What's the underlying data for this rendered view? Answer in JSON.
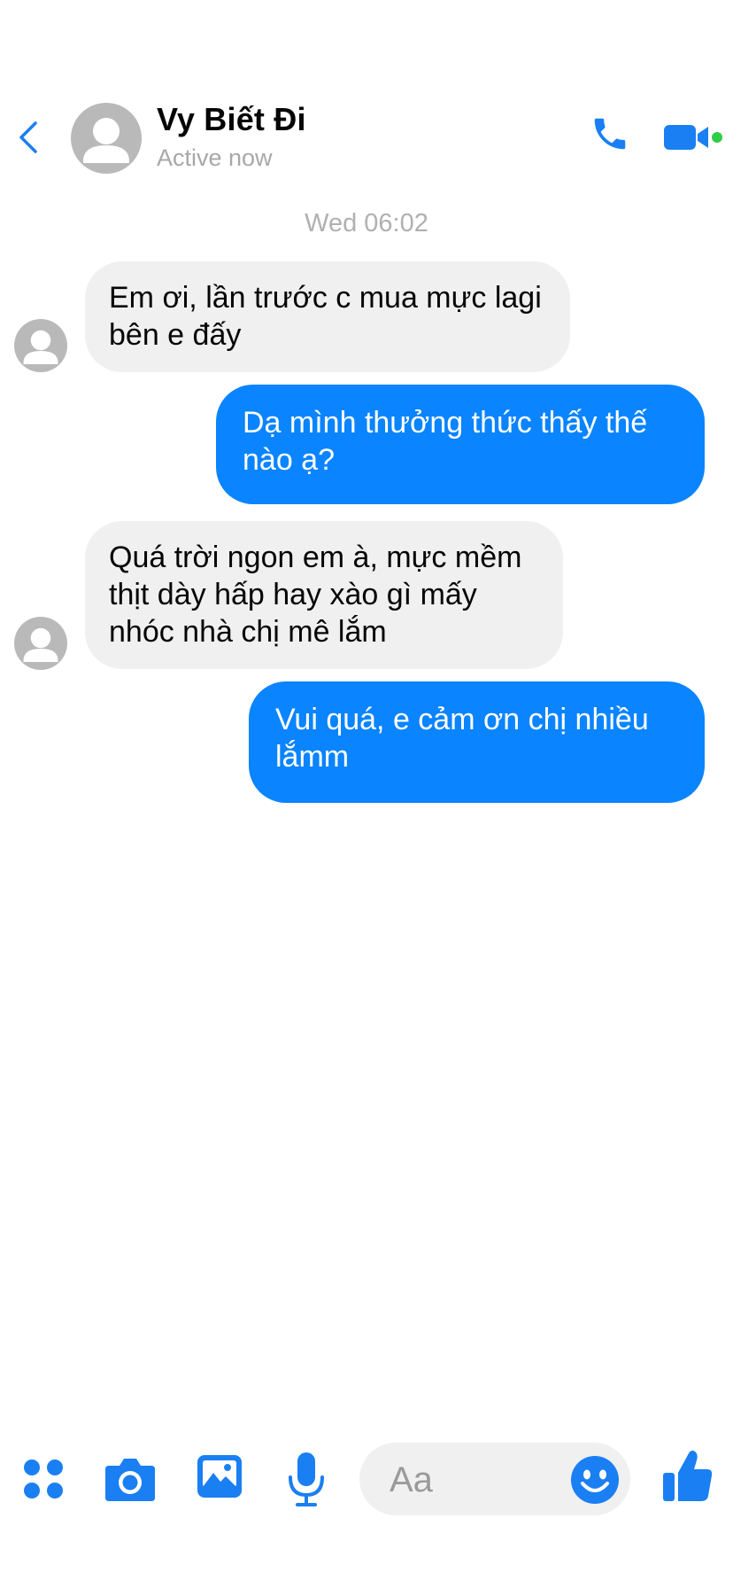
{
  "header": {
    "contact_name": "Vy Biết Đi",
    "status": "Active now"
  },
  "thread": {
    "timestamp": "Wed 06:02",
    "messages": [
      {
        "direction": "incoming",
        "text": "Em ơi, lần trước c mua mực lagi\nbên e đấy"
      },
      {
        "direction": "outgoing",
        "text": "Dạ mình thưởng thức thấy thế\nnào ạ?"
      },
      {
        "direction": "incoming",
        "text": "Quá trời ngon em à, mực mềm\nthịt dày hấp hay xào gì mấy\nnhóc nhà chị mê lắm"
      },
      {
        "direction": "outgoing",
        "text": "Vui quá, e cảm ơn chị nhiều\nlắmm"
      }
    ]
  },
  "composer": {
    "placeholder": "Aa"
  },
  "icons": {
    "back": "chevron-left-icon",
    "call": "phone-icon",
    "video": "video-camera-icon",
    "menu": "four-dots-icon",
    "camera": "camera-icon",
    "gallery": "image-icon",
    "voice": "microphone-icon",
    "emoji": "smiley-icon",
    "like": "thumbs-up-icon"
  },
  "colors": {
    "accent": "#0a84ff",
    "icon_blue": "#1a7ff2",
    "incoming_bubble": "#f0f0f0",
    "active_dot": "#31cc46",
    "avatar_gray": "#b9b9b9"
  }
}
